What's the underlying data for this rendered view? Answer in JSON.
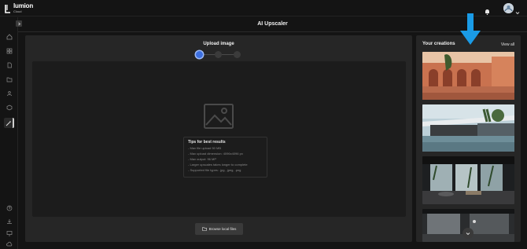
{
  "brand": {
    "name": "lumion",
    "sub": "Cloud"
  },
  "header": {
    "title": "AI Upscaler"
  },
  "upload": {
    "title": "Upload image",
    "steps": 3,
    "active_step": 1,
    "tips": {
      "title": "Tips for best results",
      "items": [
        "- Max file upload 50 MB",
        "- Max upload dimension: 4096x4096 px",
        "- Max output: 96 MP",
        "- Larger upscales takes longer to complete",
        "- Supported file types: .jpg, .jpeg, .png"
      ]
    },
    "browse_label": "Browse local files"
  },
  "creations": {
    "title": "Your creations",
    "view_all": "View all"
  },
  "colors": {
    "accent": "#3c6fe0",
    "annotation": "#1a9be6",
    "panel": "#262626",
    "background": "#141414"
  }
}
